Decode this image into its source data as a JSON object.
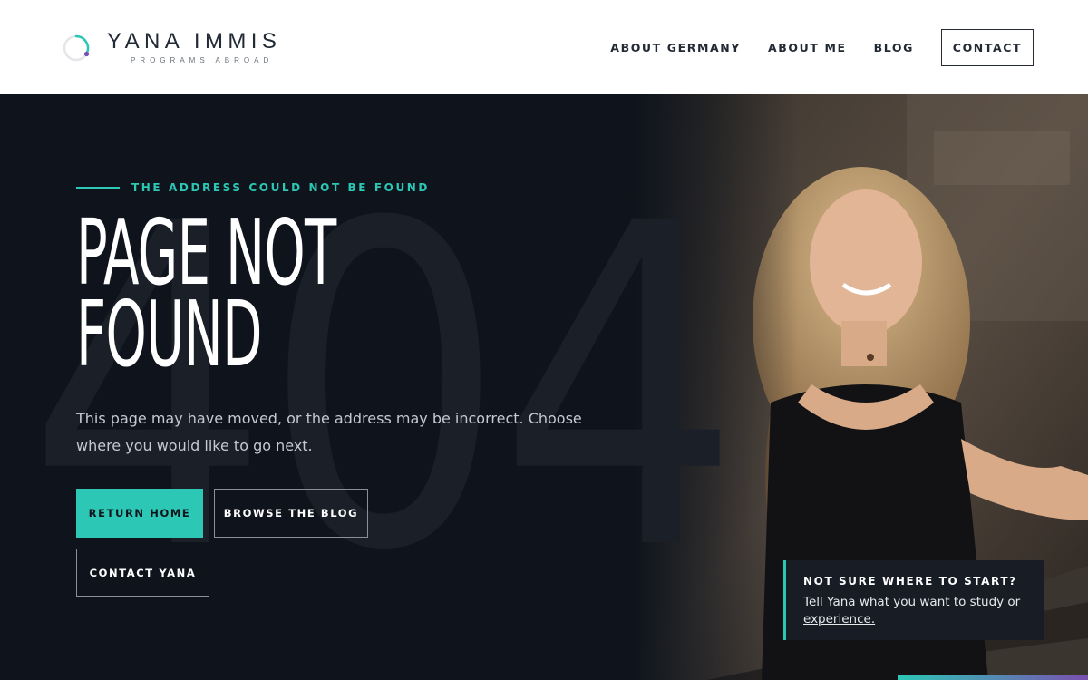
{
  "brand": {
    "name": "YANA IMMIS",
    "tagline": "PROGRAMS ABROAD",
    "colors": {
      "accent": "#2cc7b5",
      "accent_secondary": "#7a4fb0",
      "dark": "#0f141c"
    }
  },
  "nav": {
    "items": [
      {
        "label": "ABOUT GERMANY"
      },
      {
        "label": "ABOUT ME"
      },
      {
        "label": "BLOG"
      }
    ],
    "contact_label": "CONTACT"
  },
  "hero": {
    "eyebrow": "THE ADDRESS COULD NOT BE FOUND",
    "title_line1": "PAGE NOT",
    "title_line2": "FOUND",
    "background_number": "404",
    "description": "This page may have moved, or the address may be incorrect. Choose where you would like to go next.",
    "buttons": {
      "home": "RETURN HOME",
      "blog": "BROWSE THE BLOG",
      "contact": "CONTACT YANA"
    }
  },
  "help": {
    "title": "NOT SURE WHERE TO START?",
    "link": "Tell Yana what you want to study or experience."
  }
}
